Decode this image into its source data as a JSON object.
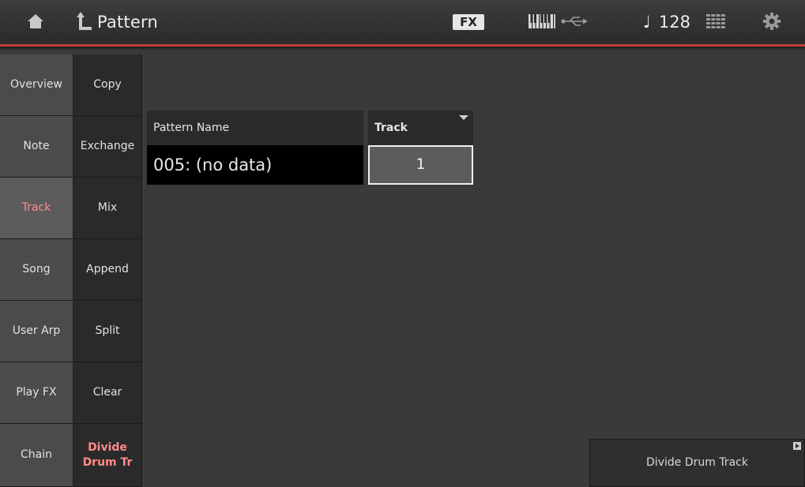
{
  "header": {
    "title": "Pattern",
    "fx_badge": "FX",
    "tempo_note": "♩",
    "tempo_value": "128",
    "icons": [
      "home-icon",
      "back-arrow-icon",
      "keyboard-icon",
      "usb-icon",
      "grid-icon",
      "gear-icon"
    ],
    "accent_color": "#c0403a"
  },
  "categories": [
    {
      "label": "Overview"
    },
    {
      "label": "Note"
    },
    {
      "label": "Track"
    },
    {
      "label": "Song"
    },
    {
      "label": "User Arp"
    },
    {
      "label": "Play FX"
    },
    {
      "label": "Chain"
    }
  ],
  "subfunctions": [
    {
      "label": "Copy"
    },
    {
      "label": "Exchange"
    },
    {
      "label": "Mix"
    },
    {
      "label": "Append"
    },
    {
      "label": "Split"
    },
    {
      "label": "Clear"
    },
    {
      "label": "Divide\nDrum Tr"
    }
  ],
  "active_category": "Track",
  "active_subfunction": "Divide Drum Tr",
  "active_color": "#ff8a8a",
  "params": {
    "pattern_name_label": "Pattern Name",
    "pattern_name_value": "005: (no data)",
    "track_label": "Track",
    "track_value": "1"
  },
  "action": {
    "divide_button_label": "Divide Drum Track"
  }
}
